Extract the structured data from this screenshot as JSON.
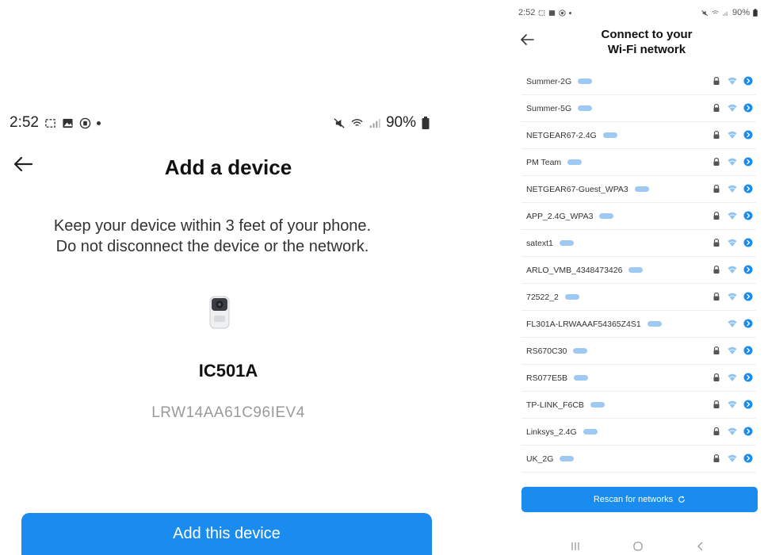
{
  "left": {
    "status": {
      "time": "2:52",
      "battery": "90%"
    },
    "title": "Add a device",
    "instruction_line1": "Keep your device within 3 feet of your phone.",
    "instruction_line2": "Do not disconnect the device or the network.",
    "device": {
      "icon": "camera-device-icon",
      "name": "IC501A",
      "serial": "LRW14AA61C96IEV4"
    },
    "add_button_label": "Add this device"
  },
  "right": {
    "status": {
      "time": "2:52",
      "battery": "90%"
    },
    "title_line1": "Connect to your",
    "title_line2": "Wi-Fi network",
    "networks": [
      {
        "name": "Summer-2G",
        "locked": true
      },
      {
        "name": "Summer-5G",
        "locked": true
      },
      {
        "name": "NETGEAR67-2.4G",
        "locked": true
      },
      {
        "name": "PM Team",
        "locked": true
      },
      {
        "name": "NETGEAR67-Guest_WPA3",
        "locked": true
      },
      {
        "name": "APP_2.4G_WPA3",
        "locked": true
      },
      {
        "name": "satext1",
        "locked": true
      },
      {
        "name": "ARLO_VMB_4348473426",
        "locked": true
      },
      {
        "name": "72522_2",
        "locked": true
      },
      {
        "name": "FL301A-LRWAAAF54365Z4S1",
        "locked": false
      },
      {
        "name": "RS670C30",
        "locked": true
      },
      {
        "name": "RS077E5B",
        "locked": true
      },
      {
        "name": "TP-LINK_F6CB",
        "locked": true
      },
      {
        "name": "Linksys_2.4G",
        "locked": true
      },
      {
        "name": "UK_2G",
        "locked": true
      }
    ],
    "rescan_label": "Rescan for networks"
  },
  "colors": {
    "accent": "#1a8cf0",
    "band_tag": "#9ec9f3",
    "wifi": "#8ec3f2"
  }
}
